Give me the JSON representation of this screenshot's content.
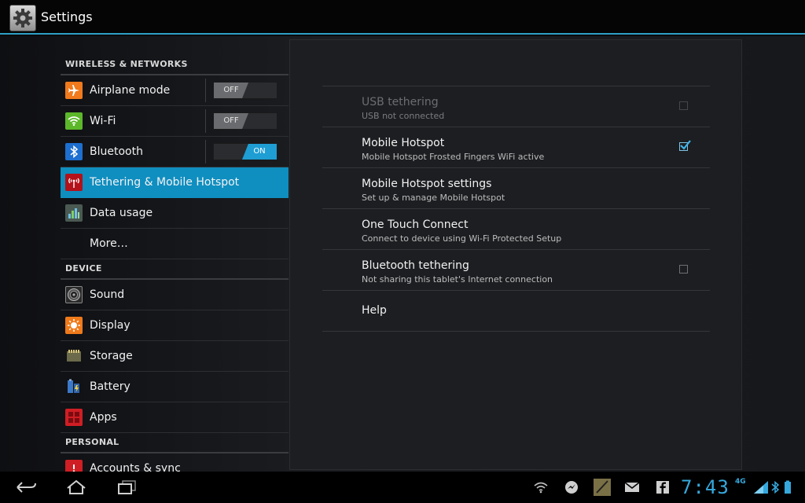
{
  "app": {
    "title": "Settings",
    "icon": "gear-icon"
  },
  "left_pane": {
    "sections": [
      {
        "header": "WIRELESS & NETWORKS",
        "items": [
          {
            "label": "Airplane mode",
            "icon": "airplane-icon",
            "toggle": "OFF"
          },
          {
            "label": "Wi-Fi",
            "icon": "wifi-icon",
            "toggle": "OFF"
          },
          {
            "label": "Bluetooth",
            "icon": "bluetooth-icon",
            "toggle": "ON"
          },
          {
            "label": "Tethering & Mobile Hotspot",
            "icon": "hotspot-icon",
            "selected": true
          },
          {
            "label": "Data usage",
            "icon": "data-usage-icon"
          },
          {
            "label": "More…"
          }
        ]
      },
      {
        "header": "DEVICE",
        "items": [
          {
            "label": "Sound",
            "icon": "speaker-icon"
          },
          {
            "label": "Display",
            "icon": "display-brightness-icon"
          },
          {
            "label": "Storage",
            "icon": "sd-card-icon"
          },
          {
            "label": "Battery",
            "icon": "battery-icon"
          },
          {
            "label": "Apps",
            "icon": "apps-icon"
          }
        ]
      },
      {
        "header": "PERSONAL",
        "items": [
          {
            "label": "Accounts & sync",
            "icon": "sync-icon"
          }
        ]
      }
    ]
  },
  "right_pane": {
    "prefs": [
      {
        "title": "USB tethering",
        "summary": "USB not connected",
        "checkbox": "unchecked",
        "disabled": true
      },
      {
        "title": "Mobile Hotspot",
        "summary": "Mobile Hotspot Frosted Fingers WiFi active",
        "checkbox": "checked"
      },
      {
        "title": "Mobile Hotspot settings",
        "summary": "Set up & manage Mobile Hotspot"
      },
      {
        "title": "One Touch Connect",
        "summary": "Connect to device using Wi-Fi Protected Setup"
      },
      {
        "title": "Bluetooth tethering",
        "summary": "Not sharing this tablet's Internet connection",
        "checkbox": "unchecked"
      },
      {
        "title": "Help"
      }
    ]
  },
  "navbar": {
    "buttons": [
      "back-icon",
      "home-icon",
      "recent-apps-icon"
    ],
    "status_icons": [
      "wifi-hotspot-icon",
      "messenger-icon",
      "note-icon",
      "gmail-icon",
      "facebook-icon"
    ],
    "clock": "7:43",
    "network": "4G",
    "accent_color": "#36a8dd"
  }
}
